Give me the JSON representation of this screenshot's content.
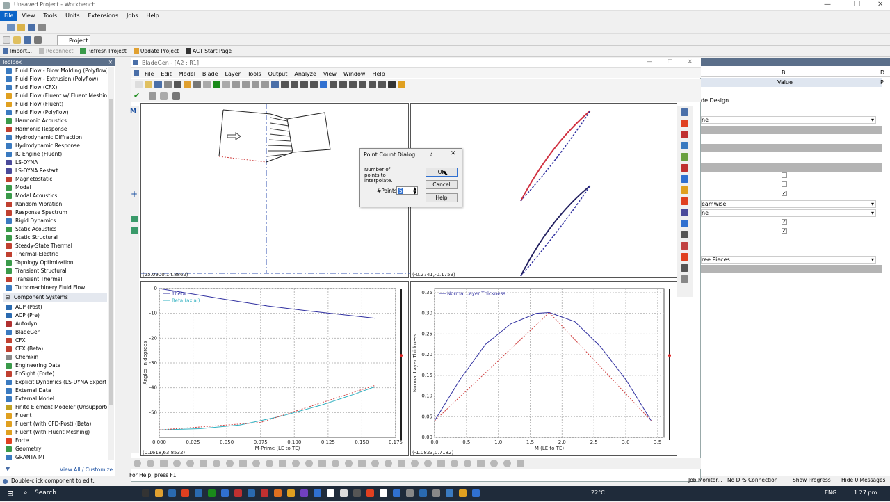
{
  "window": {
    "title": "Unsaved Project - Workbench"
  },
  "menu": [
    "File",
    "View",
    "Tools",
    "Units",
    "Extensions",
    "Jobs",
    "Help"
  ],
  "project_tab": "Project",
  "actions": {
    "import": "Import...",
    "reconnect": "Reconnect",
    "refresh": "Refresh Project",
    "update": "Update Project",
    "act": "ACT Start Page"
  },
  "toolbox": {
    "title": "Toolbox",
    "analysis_items": [
      "Fluid Flow - Blow Molding (Polyflow)",
      "Fluid Flow - Extrusion (Polyflow)",
      "Fluid Flow (CFX)",
      "Fluid Flow (Fluent w/ Fluent Meshing) (I",
      "Fluid Flow (Fluent)",
      "Fluid Flow (Polyflow)",
      "Harmonic Acoustics",
      "Harmonic Response",
      "Hydrodynamic Diffraction",
      "Hydrodynamic Response",
      "IC Engine (Fluent)",
      "LS-DYNA",
      "LS-DYNA Restart",
      "Magnetostatic",
      "Modal",
      "Modal Acoustics",
      "Random Vibration",
      "Response Spectrum",
      "Rigid Dynamics",
      "Static Acoustics",
      "Static Structural",
      "Steady-State Thermal",
      "Thermal-Electric",
      "Topology Optimization",
      "Transient Structural",
      "Transient Thermal",
      "Turbomachinery Fluid Flow"
    ],
    "section": "Component Systems",
    "component_items": [
      "ACP (Post)",
      "ACP (Pre)",
      "Autodyn",
      "BladeGen",
      "CFX",
      "CFX (Beta)",
      "Chemkin",
      "Engineering Data",
      "EnSight (Forte)",
      "Explicit Dynamics (LS-DYNA Export) (U",
      "External Data",
      "External Model",
      "Finite Element Modeler (Unsupported)",
      "Fluent",
      "Fluent (with CFD-Post) (Beta)",
      "Fluent (with Fluent Meshing)",
      "Forte",
      "Geometry",
      "GRANTA MI"
    ],
    "view_all": "View All / Customize...",
    "status": "Double-click component to edit."
  },
  "props": {
    "col_b": "B",
    "col_d": "D",
    "value_header": "Value",
    "p": "P",
    "rows": [
      "de Design",
      "ne",
      "eamwise",
      "ne",
      "ree Pieces"
    ]
  },
  "bladegen": {
    "title": "BladeGen - [A2 : R1]",
    "menu": [
      "File",
      "Edit",
      "Model",
      "Blade",
      "Layer",
      "Tools",
      "Output",
      "Analyze",
      "View",
      "Window",
      "Help"
    ],
    "pane_tl_coord": "(25.0900,14.8862)",
    "pane_tr_coord": "(-0.2741,-0.1759)",
    "pane_bl_coord": "(0.1618,63.8532)",
    "pane_br_coord": "(-1.0823,0.7182)",
    "help_text": "For Help, press F1",
    "left_tool_m": "M"
  },
  "chart_data": [
    {
      "type": "line",
      "xlabel": "M-Prime (LE to TE)",
      "ylabel": "Angles in degrees",
      "xlim": [
        0.0,
        0.175
      ],
      "ylim": [
        -60,
        0
      ],
      "xticks": [
        "0.000",
        "0.025",
        "0.050",
        "0.075",
        "0.100",
        "0.125",
        "0.150",
        "0.175"
      ],
      "yticks": [
        "0",
        "-10",
        "-20",
        "-30",
        "-40",
        "-50"
      ],
      "series": [
        {
          "name": "Theta",
          "color": "#3030a0",
          "x": [
            0,
            0.02,
            0.05,
            0.08,
            0.11,
            0.14,
            0.16
          ],
          "y": [
            0,
            -1.8,
            -4.5,
            -7,
            -9,
            -10.8,
            -12
          ]
        },
        {
          "name": "Beta (axial)",
          "color": "#30b0c0",
          "x": [
            0,
            0.03,
            0.06,
            0.09,
            0.12,
            0.145,
            0.16
          ],
          "y": [
            -57,
            -56.5,
            -55,
            -51.5,
            -47,
            -42.5,
            -39.5
          ]
        },
        {
          "name": "",
          "color": "#d04040",
          "dashed": true,
          "x": [
            0,
            0.075,
            0.16
          ],
          "y": [
            -57,
            -54,
            -39
          ]
        }
      ]
    },
    {
      "type": "line",
      "xlabel": "M (LE to TE)",
      "ylabel": "Normal Layer Thickness",
      "xlim": [
        0.0,
        3.6
      ],
      "ylim": [
        0.0,
        0.36
      ],
      "xticks": [
        "0.0",
        "0.5",
        "1.0",
        "1.5",
        "2.0",
        "2.5",
        "3.0",
        "3.5"
      ],
      "yticks": [
        "0.35",
        "0.30",
        "0.25",
        "0.20",
        "0.15",
        "0.10",
        "0.05",
        "0.00"
      ],
      "series": [
        {
          "name": "Normal Layer Thickness",
          "color": "#3030a0",
          "x": [
            0,
            0.4,
            0.8,
            1.2,
            1.6,
            1.8,
            2.2,
            2.6,
            3.0,
            3.4
          ],
          "y": [
            0.04,
            0.14,
            0.225,
            0.275,
            0.3,
            0.302,
            0.28,
            0.22,
            0.14,
            0.04
          ]
        },
        {
          "name": "",
          "color": "#d04040",
          "dashed": true,
          "x": [
            0,
            1.8,
            3.4
          ],
          "y": [
            0.04,
            0.302,
            0.04
          ]
        }
      ]
    }
  ],
  "dialog": {
    "title": "Point Count Dialog",
    "help_q": "?",
    "text": "Number of points to interpolate.",
    "label": "#Points:",
    "value": "5",
    "ok": "OK",
    "cancel": "Cancel",
    "help": "Help"
  },
  "status_right": [
    "Job Monitor...",
    "No DPS Connection",
    "Show Progress",
    "Hide 0 Messages"
  ],
  "taskbar": {
    "search": "Search",
    "temp": "22°C",
    "lang": "ENG",
    "time": "1:27 pm"
  }
}
